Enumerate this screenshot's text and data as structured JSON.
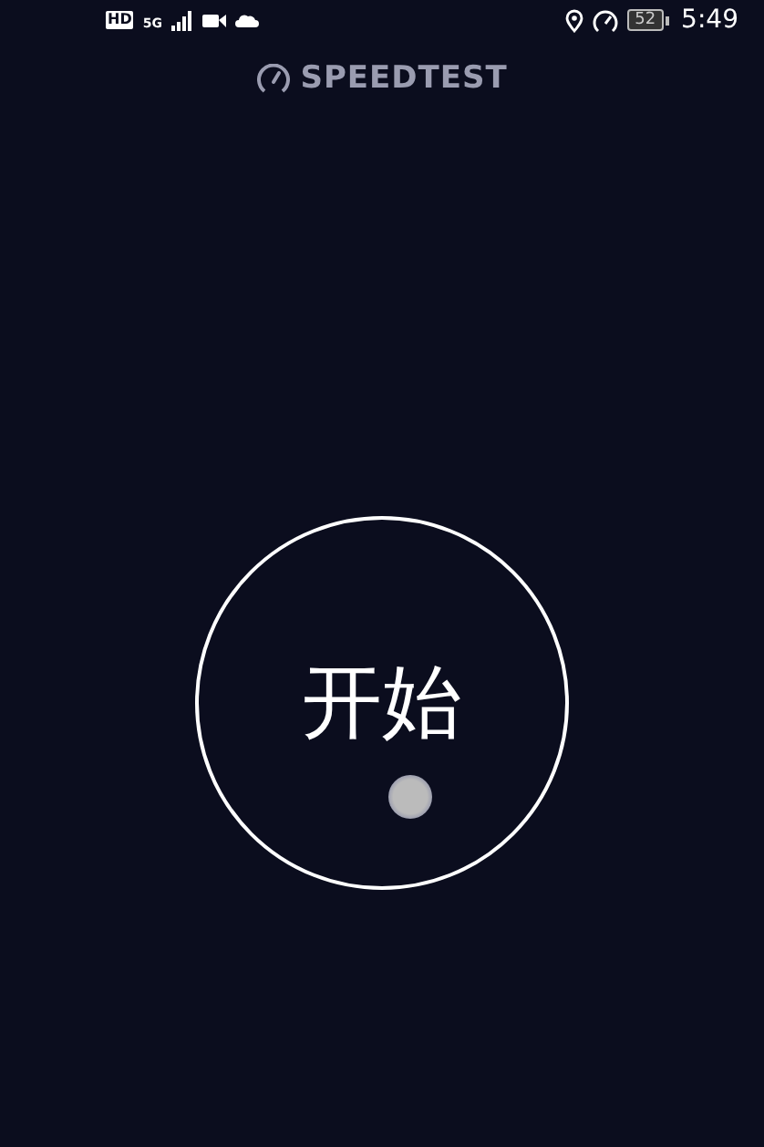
{
  "status_bar": {
    "hd_badge": "HD",
    "network": "5G",
    "battery": "52",
    "time": "5:49"
  },
  "header": {
    "title": "SPEEDTEST"
  },
  "start_button": {
    "label": "开始"
  }
}
